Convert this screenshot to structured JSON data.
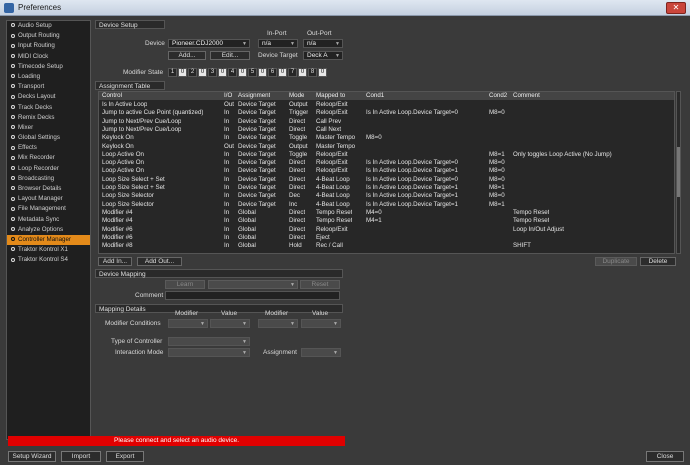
{
  "window": {
    "title": "Preferences"
  },
  "sidebar": {
    "items": [
      {
        "label": "Audio Setup"
      },
      {
        "label": "Output Routing"
      },
      {
        "label": "Input Routing"
      },
      {
        "label": "MIDI Clock"
      },
      {
        "label": "Timecode Setup"
      },
      {
        "label": "Loading"
      },
      {
        "label": "Transport"
      },
      {
        "label": "Decks Layout"
      },
      {
        "label": "Track Decks"
      },
      {
        "label": "Remix Decks"
      },
      {
        "label": "Mixer"
      },
      {
        "label": "Global Settings"
      },
      {
        "label": "Effects"
      },
      {
        "label": "Mix Recorder"
      },
      {
        "label": "Loop Recorder"
      },
      {
        "label": "Broadcasting"
      },
      {
        "label": "Browser Details"
      },
      {
        "label": "Layout Manager"
      },
      {
        "label": "File Management"
      },
      {
        "label": "Metadata Sync"
      },
      {
        "label": "Analyze Options"
      },
      {
        "label": "Controller Manager",
        "active": true
      },
      {
        "label": "Traktor Kontrol X1"
      },
      {
        "label": "Traktor Kontrol S4"
      }
    ]
  },
  "device_setup": {
    "header": "Device Setup",
    "device_label": "Device",
    "device_value": "Pioneer.CDJ2000",
    "in_port_label": "In-Port",
    "in_port_value": "n/a",
    "out_port_label": "Out-Port",
    "out_port_value": "n/a",
    "add_label": "Add...",
    "edit_label": "Edit...",
    "device_target_label": "Device Target",
    "device_target_value": "Deck A",
    "modifier_state_label": "Modifier State",
    "modifier_state": [
      {
        "num": "1",
        "val": "0"
      },
      {
        "num": "2",
        "val": "0"
      },
      {
        "num": "3",
        "val": "0"
      },
      {
        "num": "4",
        "val": "0"
      },
      {
        "num": "5",
        "val": "0"
      },
      {
        "num": "6",
        "val": "0"
      },
      {
        "num": "7",
        "val": "0"
      },
      {
        "num": "8",
        "val": "0"
      }
    ]
  },
  "assignment_table": {
    "header": "Assignment Table",
    "columns": [
      "Control",
      "I/O",
      "Assignment",
      "Mode",
      "Mapped to",
      "Cond1",
      "Cond2",
      "Comment"
    ],
    "rows": [
      [
        "Is In Active Loop",
        "Out",
        "Device Target",
        "Output",
        "Reloop/Exit",
        "",
        "",
        ""
      ],
      [
        "Jump to active Cue Point (quantized)",
        "In",
        "Device Target",
        "Trigger",
        "Reloop/Exit",
        "Is In Active Loop.Device Target=0",
        "M8=0",
        ""
      ],
      [
        "Jump to Next/Prev Cue/Loop",
        "In",
        "Device Target",
        "Direct",
        "Call Prev",
        "",
        "",
        ""
      ],
      [
        "Jump to Next/Prev Cue/Loop",
        "In",
        "Device Target",
        "Direct",
        "Call Next",
        "",
        "",
        ""
      ],
      [
        "Keylock On",
        "In",
        "Device Target",
        "Toggle",
        "Master Tempo",
        "M8=0",
        "",
        ""
      ],
      [
        "Keylock On",
        "Out",
        "Device Target",
        "Output",
        "Master Tempo",
        "",
        "",
        ""
      ],
      [
        "Loop Active On",
        "In",
        "Device Target",
        "Toggle",
        "Reloop/Exit",
        "",
        "M8=1",
        "Only toggles Loop Active (No Jump)"
      ],
      [
        "Loop Active On",
        "In",
        "Device Target",
        "Direct",
        "Reloop/Exit",
        "Is In Active Loop.Device Target=0",
        "M8=0",
        ""
      ],
      [
        "Loop Active On",
        "In",
        "Device Target",
        "Direct",
        "Reloop/Exit",
        "Is In Active Loop.Device Target=1",
        "M8=0",
        ""
      ],
      [
        "Loop Size Select + Set",
        "In",
        "Device Target",
        "Direct",
        "4-Beat Loop",
        "Is In Active Loop.Device Target=0",
        "M8=0",
        ""
      ],
      [
        "Loop Size Select + Set",
        "In",
        "Device Target",
        "Direct",
        "4-Beat Loop",
        "Is In Active Loop.Device Target=1",
        "M8=1",
        ""
      ],
      [
        "Loop Size Selector",
        "In",
        "Device Target",
        "Dec",
        "4-Beat Loop",
        "Is In Active Loop.Device Target=1",
        "M8=0",
        ""
      ],
      [
        "Loop Size Selector",
        "In",
        "Device Target",
        "Inc",
        "4-Beat Loop",
        "Is In Active Loop.Device Target=1",
        "M8=1",
        ""
      ],
      [
        "Modifier #4",
        "In",
        "Global",
        "Direct",
        "Tempo Reset",
        "M4=0",
        "",
        "Tempo Reset"
      ],
      [
        "Modifier #4",
        "In",
        "Global",
        "Direct",
        "Tempo Reset",
        "M4=1",
        "",
        "Tempo Reset"
      ],
      [
        "Modifier #6",
        "In",
        "Global",
        "Direct",
        "Reloop/Exit",
        "",
        "",
        "Loop In/Out Adjust"
      ],
      [
        "Modifier #6",
        "In",
        "Global",
        "Direct",
        "Eject",
        "",
        "",
        ""
      ],
      [
        "Modifier #8",
        "In",
        "Global",
        "Hold",
        "Rec / Call",
        "",
        "",
        "SHIFT"
      ]
    ],
    "add_in_label": "Add In...",
    "add_out_label": "Add Out...",
    "duplicate_label": "Duplicate",
    "delete_label": "Delete"
  },
  "device_mapping": {
    "header": "Device Mapping",
    "learn_label": "Learn",
    "reset_label": "Reset",
    "comment_label": "Comment"
  },
  "mapping_details": {
    "header": "Mapping Details",
    "modifier_col": "Modifier",
    "value_col": "Value",
    "modifier_conditions_label": "Modifier Conditions",
    "type_of_controller_label": "Type of Controller",
    "interaction_mode_label": "Interaction Mode",
    "assignment_label": "Assignment"
  },
  "status": {
    "message": "Please connect and select an audio device."
  },
  "footer": {
    "setup_wizard_label": "Setup Wizard",
    "import_label": "Import",
    "export_label": "Export",
    "close_label": "Close"
  },
  "colors": {
    "accent": "#e38a1a",
    "error": "#e00000",
    "background": "#3a3a3a"
  }
}
